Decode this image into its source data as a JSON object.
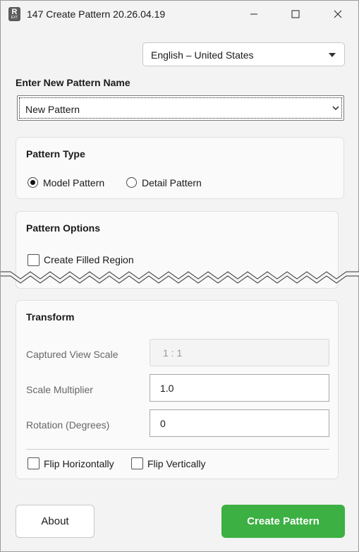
{
  "window": {
    "title": "147 Create Pattern 20.26.04.19",
    "icon_letter": "R",
    "icon_subtext": "EXT"
  },
  "language": {
    "selected": "English – United States"
  },
  "pattern_name": {
    "label": "Enter New Pattern Name",
    "value": "New Pattern"
  },
  "pattern_type": {
    "title": "Pattern Type",
    "options": [
      {
        "label": "Model Pattern",
        "checked": true
      },
      {
        "label": "Detail Pattern",
        "checked": false
      }
    ]
  },
  "pattern_options": {
    "title": "Pattern Options",
    "create_filled_region": {
      "label": "Create Filled Region",
      "checked": false
    }
  },
  "transform": {
    "title": "Transform",
    "captured_view_scale": {
      "label": "Captured View Scale",
      "value": "1 : 1",
      "disabled": true
    },
    "scale_multiplier": {
      "label": "Scale Multiplier",
      "value": "1.0"
    },
    "rotation": {
      "label": "Rotation (Degrees)",
      "value": "0"
    },
    "flip_horizontally": {
      "label": "Flip Horizontally",
      "checked": false
    },
    "flip_vertically": {
      "label": "Flip Vertically",
      "checked": false
    }
  },
  "buttons": {
    "about": "About",
    "create": "Create Pattern"
  },
  "colors": {
    "accent": "#3cb043",
    "background": "#f3f3f3",
    "card": "#fafafa"
  },
  "icons": [
    "app-icon",
    "minimize-icon",
    "maximize-icon",
    "close-icon",
    "dropdown-caret-icon",
    "chevron-down-icon"
  ]
}
